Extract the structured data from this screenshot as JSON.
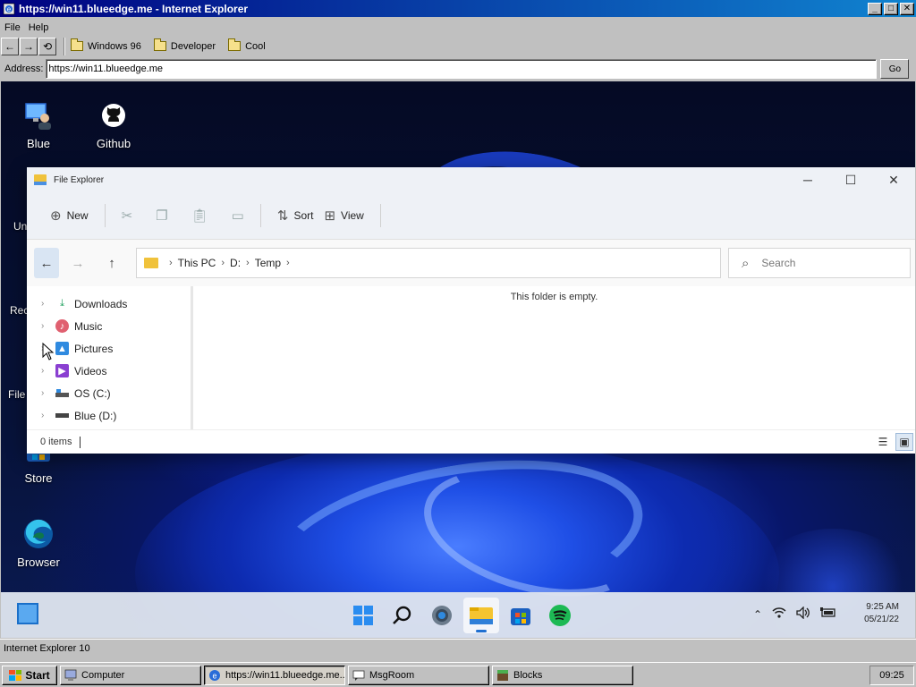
{
  "ie": {
    "title": "https://win11.blueedge.me - Internet Explorer",
    "menu": [
      "File",
      "Help"
    ],
    "favorites": [
      "Windows 96",
      "Developer",
      "Cool"
    ],
    "address_label": "Address:",
    "address_value": "https://win11.blueedge.me",
    "go_label": "Go",
    "status_text": "Internet Explorer 10"
  },
  "desktop": {
    "icons": [
      {
        "label": "Blue",
        "icon": "user-monitor-icon"
      },
      {
        "label": "Github",
        "icon": "github-icon"
      },
      {
        "label": "Store",
        "icon": "store-icon"
      },
      {
        "label": "Browser",
        "icon": "edge-icon"
      }
    ],
    "partial_labels": [
      "Un",
      "Rec",
      "File"
    ]
  },
  "explorer": {
    "title": "File Explorer",
    "commands": {
      "new": "New",
      "sort": "Sort",
      "view": "View"
    },
    "breadcrumb": [
      "This PC",
      "D:",
      "Temp"
    ],
    "search_placeholder": "Search",
    "nav_items": [
      {
        "label": "Downloads",
        "icon": "download-icon"
      },
      {
        "label": "Music",
        "icon": "music-icon"
      },
      {
        "label": "Pictures",
        "icon": "pictures-icon"
      },
      {
        "label": "Videos",
        "icon": "videos-icon"
      },
      {
        "label": "OS (C:)",
        "icon": "drive-c-icon"
      },
      {
        "label": "Blue (D:)",
        "icon": "drive-d-icon"
      }
    ],
    "empty_message": "This folder is empty.",
    "status": "0 items"
  },
  "win11_taskbar": {
    "apps": [
      "start-icon",
      "search-icon",
      "settings-icon",
      "file-explorer-icon",
      "store-icon",
      "spotify-icon"
    ],
    "active_app": "file-explorer-icon",
    "time": "9:25 AM",
    "date": "05/21/22"
  },
  "taskbar98": {
    "start_label": "Start",
    "tasks": [
      {
        "label": "Computer"
      },
      {
        "label": "https://win11.blueedge.me..."
      },
      {
        "label": "MsgRoom"
      },
      {
        "label": "Blocks"
      }
    ],
    "active_task": 1,
    "clock": "09:25"
  },
  "colors": {
    "win98_face": "#c0c0c0",
    "title_active": "#000080",
    "accent_win11": "#1f6fd1"
  }
}
